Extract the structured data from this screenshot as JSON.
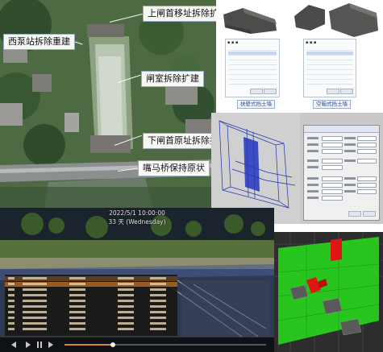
{
  "aerial": {
    "labels": {
      "upper_gate": "上闸首移址拆除扩建",
      "pump_station": "西泵站拆除重建",
      "chamber": "闸室拆除扩建",
      "lower_gate": "下闸首原址拆除扩建",
      "bridge": "嘴马桥保持原状"
    },
    "colors": {
      "label_bg": "#ffffff",
      "label_text": "#111111",
      "leader": "#f5f5f5"
    }
  },
  "cad": {
    "captions": [
      "扶壁式挡土墙",
      "空箱式挡土墙"
    ],
    "colors": {
      "mesh": "#4b4d4a",
      "caption_text": "#2a4c88"
    }
  },
  "mesh_dialog": {
    "colors": {
      "wire": "#1f2fb0",
      "background": "#c9c9c9"
    }
  },
  "sim": {
    "date_line": "2022/5/1 10:00:00",
    "day_line": "33 天 (Wednesday)",
    "colors": {
      "sky": "#1b232c",
      "grass": "#57703c",
      "row_highlight": "#9a5b21"
    }
  },
  "bim": {
    "colors": {
      "ground": "#29c51f",
      "highlight": "#e01515",
      "background": "#2d2d2d"
    }
  }
}
